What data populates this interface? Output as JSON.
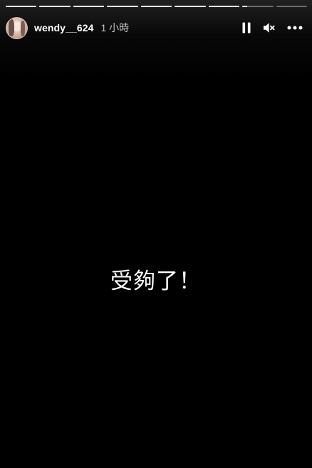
{
  "story": {
    "progress": [
      1,
      1,
      1,
      1,
      1,
      1,
      1,
      0.15,
      0
    ],
    "user": {
      "username": "wendy__624",
      "time_ago": "1 小時"
    },
    "controls": {
      "pause_icon": "pause-icon",
      "mute_icon": "muted-speaker-icon",
      "more_icon": "more-horizontal-icon"
    },
    "text": "受夠了！"
  }
}
